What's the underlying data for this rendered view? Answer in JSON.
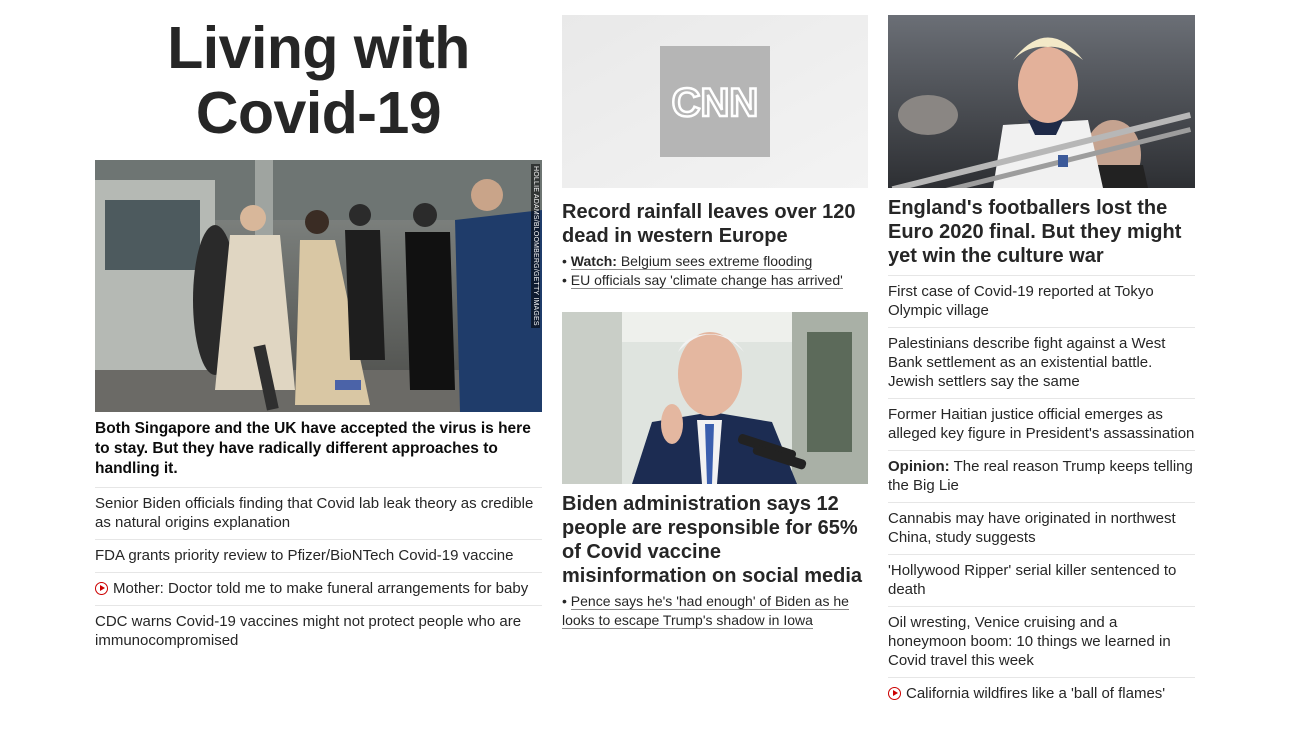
{
  "zone": {
    "title_line1": "Living with",
    "title_line2": "Covid-19"
  },
  "col1": {
    "image_credit": "HOLLIE ADAMS/BLOOMBERG/GETTY IMAGES",
    "headline": "Both Singapore and the UK have accepted the virus is here to stay. But they have radically different approaches to handling it.",
    "items": [
      "Senior Biden officials finding that Covid lab leak theory as credible as natural origins explanation",
      "FDA grants priority review to Pfizer/BioNTech Covid-19 vaccine",
      "Mother: Doctor told me to make funeral arrangements for baby",
      "CDC warns Covid-19 vaccines might not protect people who are immunocompromised"
    ]
  },
  "col2": {
    "logo_text": "CNN",
    "story1_headline": "Record rainfall leaves over 120 dead in western Europe",
    "story1_sub1_prefix": "Watch:",
    "story1_sub1_text": "Belgium sees extreme flooding",
    "story1_sub2": "EU officials say 'climate change has arrived'",
    "story2_headline": "Biden administration says 12 people are responsible for 65% of Covid vaccine misinformation on social media",
    "story2_sub1": "Pence says he's 'had enough' of Biden as he looks to escape Trump's shadow in Iowa"
  },
  "col3": {
    "headline": "England's footballers lost the Euro 2020 final. But they might yet win the culture war",
    "items": [
      "First case of Covid-19 reported at Tokyo Olympic village",
      "Palestinians describe fight against a West Bank settlement as an existential battle. Jewish settlers say the same",
      "Former Haitian justice official emerges as alleged key figure in President's assassination",
      "The real reason Trump keeps telling the Big Lie",
      "Cannabis may have originated in northwest China, study suggests",
      "'Hollywood Ripper' serial killer sentenced to death",
      "Oil wresting, Venice cruising and a honeymoon boom: 10 things we learned in Covid travel this week",
      "California wildfires like a 'ball of flames'"
    ],
    "opinion_prefix": "Opinion:"
  },
  "colors": {
    "play_icon": "#cc0000",
    "text": "#262626",
    "divider": "#e6e6e6"
  }
}
